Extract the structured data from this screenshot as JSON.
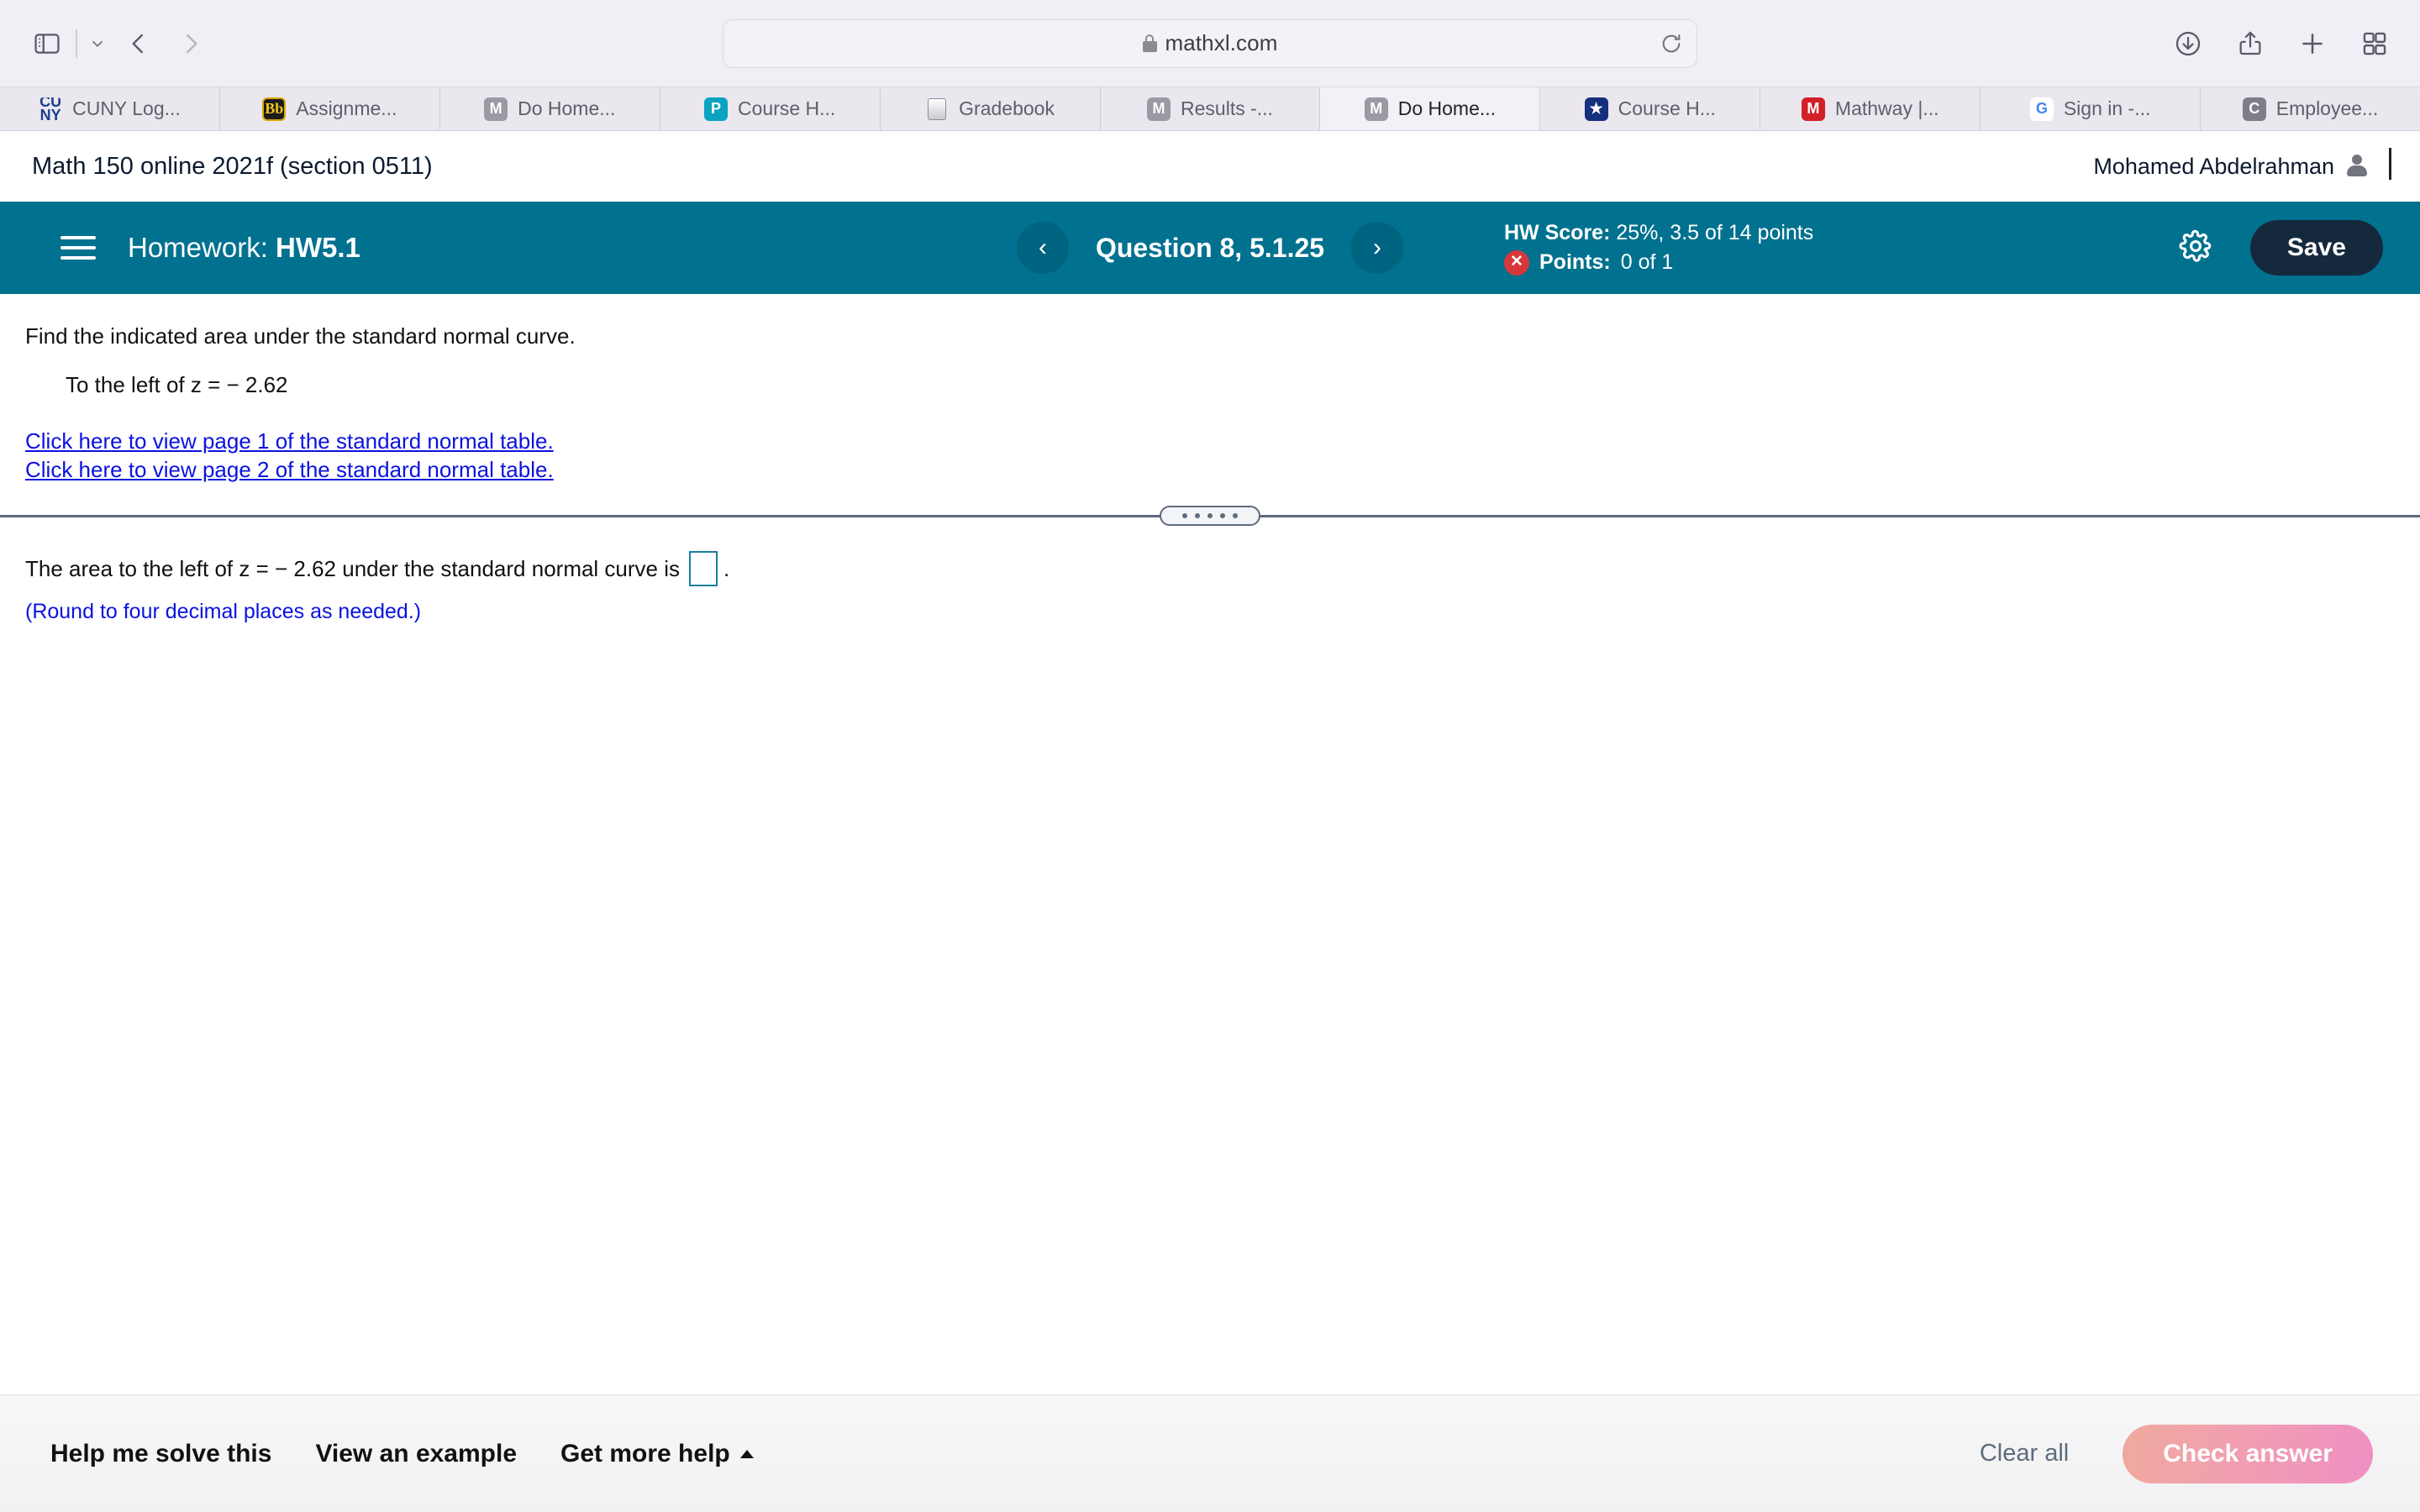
{
  "browser": {
    "url": "mathxl.com",
    "lock_icon": "lock-icon",
    "reload_icon": "reload-icon",
    "sidebar_icon": "sidebar-toggle-icon",
    "back_icon": "chevron-left-icon",
    "forward_icon": "chevron-right-icon",
    "shield_icon": "privacy-shield-icon",
    "downloads_icon": "downloads-icon",
    "share_icon": "share-icon",
    "new_tab_icon": "plus-icon",
    "tab_overview_icon": "tab-overview-icon",
    "tabs": [
      {
        "label": "CUNY Log...",
        "icon": "cuny-favicon",
        "active": false
      },
      {
        "label": "Assignme...",
        "icon": "blackboard-favicon",
        "active": false
      },
      {
        "label": "Do Home...",
        "icon": "mathxl-favicon",
        "active": false
      },
      {
        "label": "Course H...",
        "icon": "pearson-favicon",
        "active": false
      },
      {
        "label": "Gradebook",
        "icon": "document-favicon",
        "active": false
      },
      {
        "label": "Results -...",
        "icon": "mathxl-favicon",
        "active": false
      },
      {
        "label": "Do Home...",
        "icon": "mathxl-favicon",
        "active": true
      },
      {
        "label": "Course H...",
        "icon": "star-shield-favicon",
        "active": false
      },
      {
        "label": "Mathway |...",
        "icon": "mathway-favicon",
        "active": false
      },
      {
        "label": "Sign in -...",
        "icon": "google-favicon",
        "active": false
      },
      {
        "label": "Employee...",
        "icon": "c-favicon",
        "active": false
      }
    ]
  },
  "page_header": {
    "course_title": "Math 150 online 2021f (section 0511)",
    "user_name": "Mohamed Abdelrahman",
    "user_icon": "person-icon"
  },
  "hw_bar": {
    "menu_icon": "hamburger-menu-icon",
    "label_prefix": "Homework:",
    "assignment": "HW5.1",
    "prev_icon": "‹",
    "next_icon": "›",
    "question_label": "Question 8, 5.1.25",
    "hw_score_label": "HW Score:",
    "hw_score_value": "25%, 3.5 of 14 points",
    "points_label": "Points:",
    "points_value": "0 of 1",
    "points_status_icon": "incorrect-x-icon",
    "settings_icon": "gear-icon",
    "save_label": "Save",
    "bar_color": "#00718f",
    "save_color": "#15293c",
    "status_color": "#d8363a"
  },
  "question": {
    "prompt": "Find the indicated area under the standard normal curve.",
    "detail": "To the left of z = − 2.62",
    "links": [
      "Click here to view page 1 of the standard normal table.",
      "Click here to view page 2 of the standard normal table."
    ],
    "link_color": "#0a12e0",
    "splitter_icon": "splitter-handle"
  },
  "answer": {
    "text_before": "The area to the left of z = − 2.62 under the standard normal curve is",
    "input_value": "",
    "text_after": ".",
    "note": "(Round to four decimal places as needed.)",
    "input_border_color": "#1a7d9e"
  },
  "bottom_bar": {
    "links": [
      {
        "label": "Help me solve this",
        "caret": false
      },
      {
        "label": "View an example",
        "caret": false
      },
      {
        "label": "Get more help",
        "caret": true
      }
    ],
    "clear_all_label": "Clear all",
    "check_answer_label": "Check answer"
  }
}
